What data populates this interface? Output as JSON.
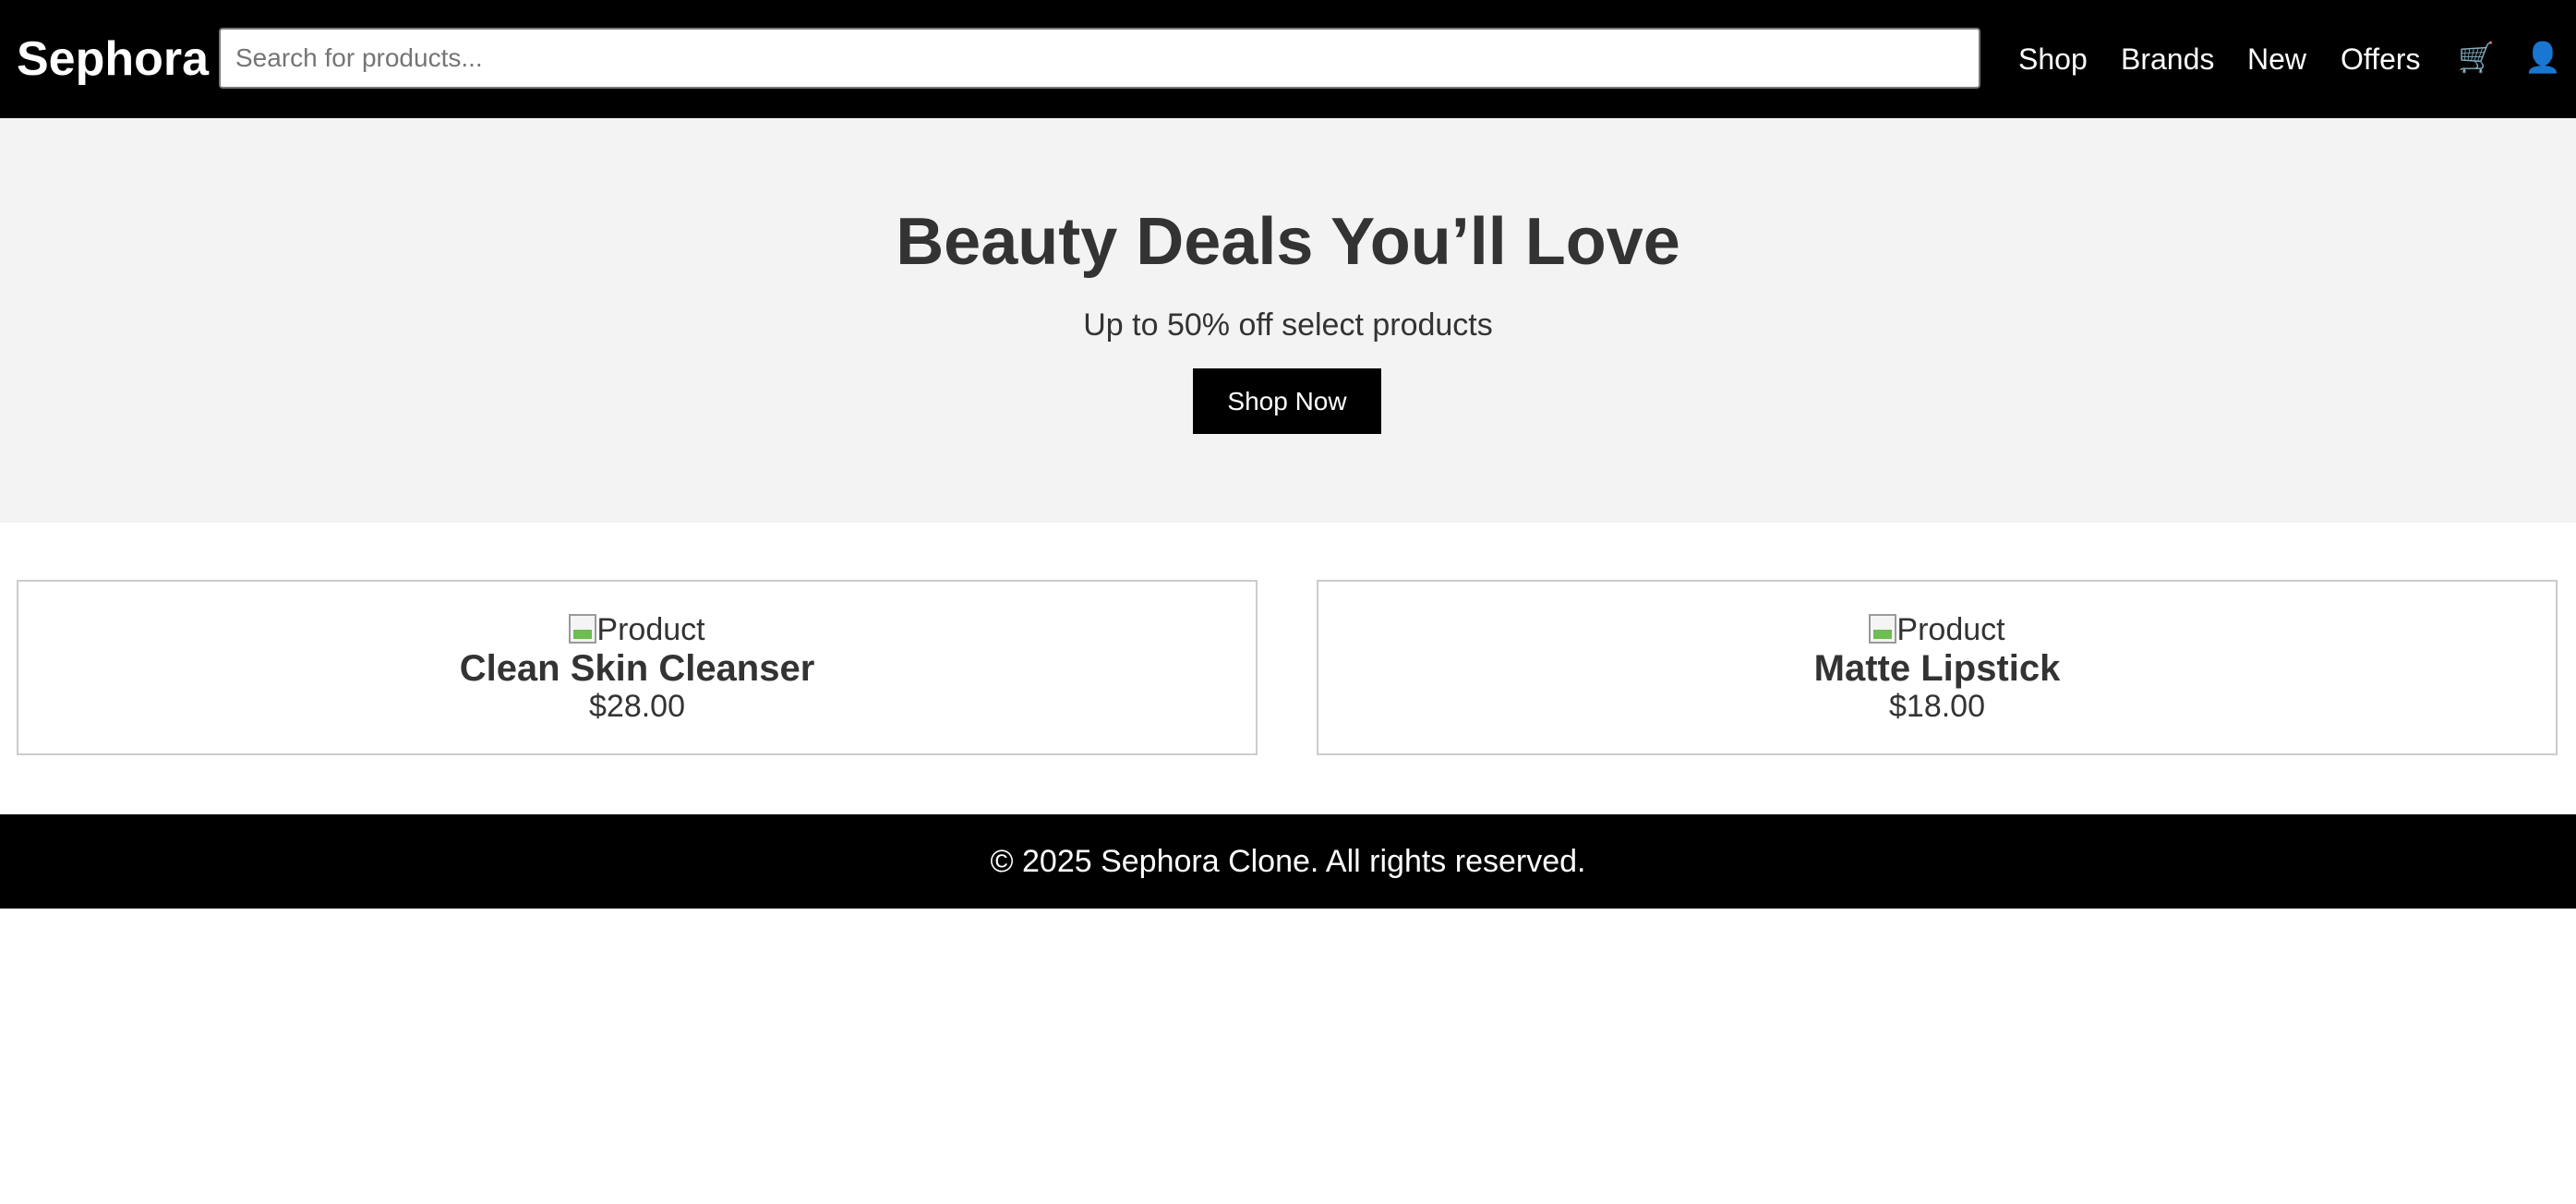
{
  "header": {
    "logo": "Sephora",
    "search": {
      "placeholder": "Search for products...",
      "value": ""
    },
    "nav": [
      "Shop",
      "Brands",
      "New",
      "Offers"
    ],
    "icons": [
      "cart-icon",
      "user-icon"
    ]
  },
  "hero": {
    "title": "Beauty Deals You’ll Love",
    "subtitle": "Up to 50% off select products",
    "cta": "Shop Now"
  },
  "products": [
    {
      "image_alt": "Product",
      "name": "Clean Skin Cleanser",
      "price": "$28.00"
    },
    {
      "image_alt": "Product",
      "name": "Matte Lipstick",
      "price": "$18.00"
    }
  ],
  "footer": {
    "text": "© 2025 Sephora Clone. All rights reserved."
  },
  "colors": {
    "header_bg": "#000000",
    "hero_bg": "#f3f3f3",
    "text": "#333333",
    "button_bg": "#000000",
    "card_border": "#cccccc"
  }
}
